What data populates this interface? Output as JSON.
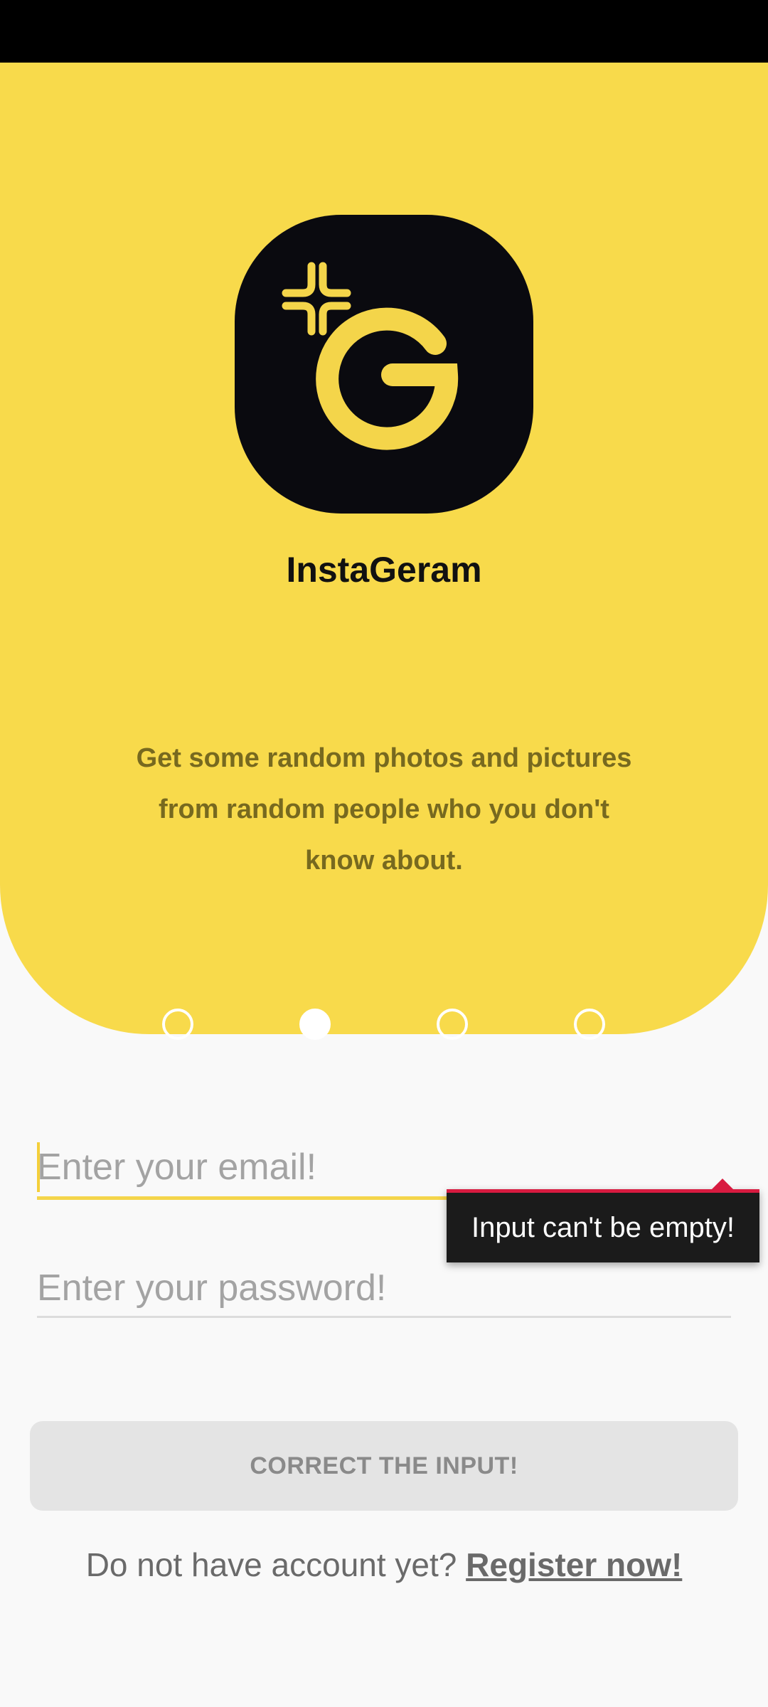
{
  "app": {
    "name": "InstaGeram",
    "tagline": "Get some random photos and pictures from random people who you don't know about.",
    "logo_icon": "sparkle-g-logo-icon"
  },
  "colors": {
    "accent_yellow": "#f8da4b",
    "logo_background": "#0a0a0f",
    "tagline_text": "#77691f",
    "error_red": "#d81b40",
    "page_background": "#f9f9f9"
  },
  "pager": {
    "count": 4,
    "active_index": 1
  },
  "form": {
    "email": {
      "value": "",
      "placeholder": "Enter your email!",
      "error": "Input can't be empty!"
    },
    "password": {
      "value": "",
      "placeholder": "Enter your password!"
    },
    "submit_label": "CORRECT THE INPUT!"
  },
  "register": {
    "prompt": "Do not have account yet?",
    "link_label": "Register now!"
  }
}
